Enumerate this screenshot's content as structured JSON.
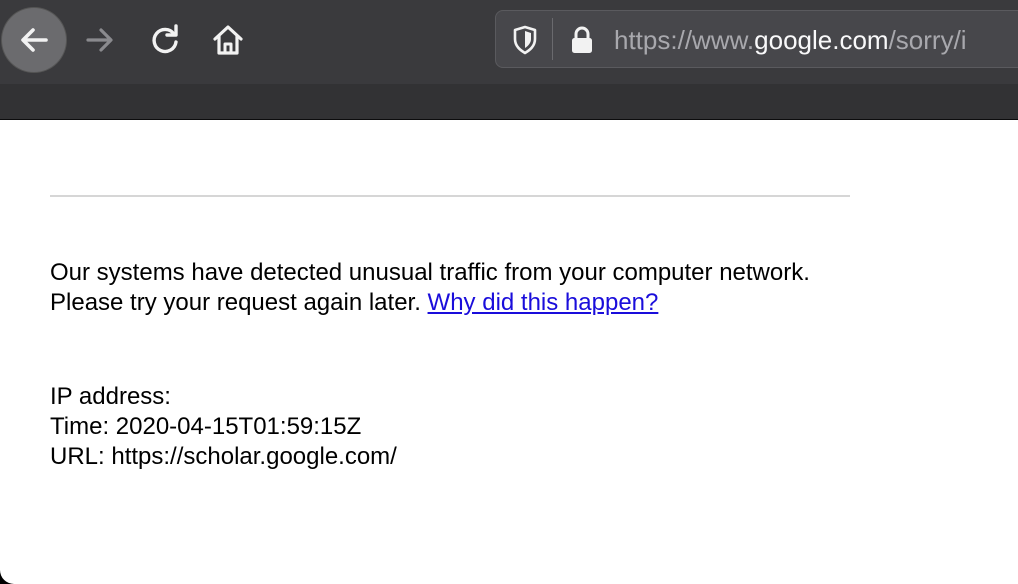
{
  "browser": {
    "url_prefix": "https://www.",
    "url_domain": "google.com",
    "url_suffix": "/sorry/i",
    "icons": {
      "back": "back-arrow-icon",
      "forward": "forward-arrow-icon",
      "reload": "reload-icon",
      "home": "home-icon",
      "tracking": "shield-icon",
      "security": "lock-icon"
    },
    "colors": {
      "toolbar": "#3a3a3d",
      "urlbar": "#47474b",
      "link": "#1a0ddb"
    }
  },
  "page": {
    "message": "Our systems have detected unusual traffic from your computer network. Please try your request again later.",
    "link_text": "Why did this happen?",
    "ip_label": "IP address:",
    "time_line": "Time: 2020-04-15T01:59:15Z",
    "url_line": "URL: https://scholar.google.com/"
  }
}
